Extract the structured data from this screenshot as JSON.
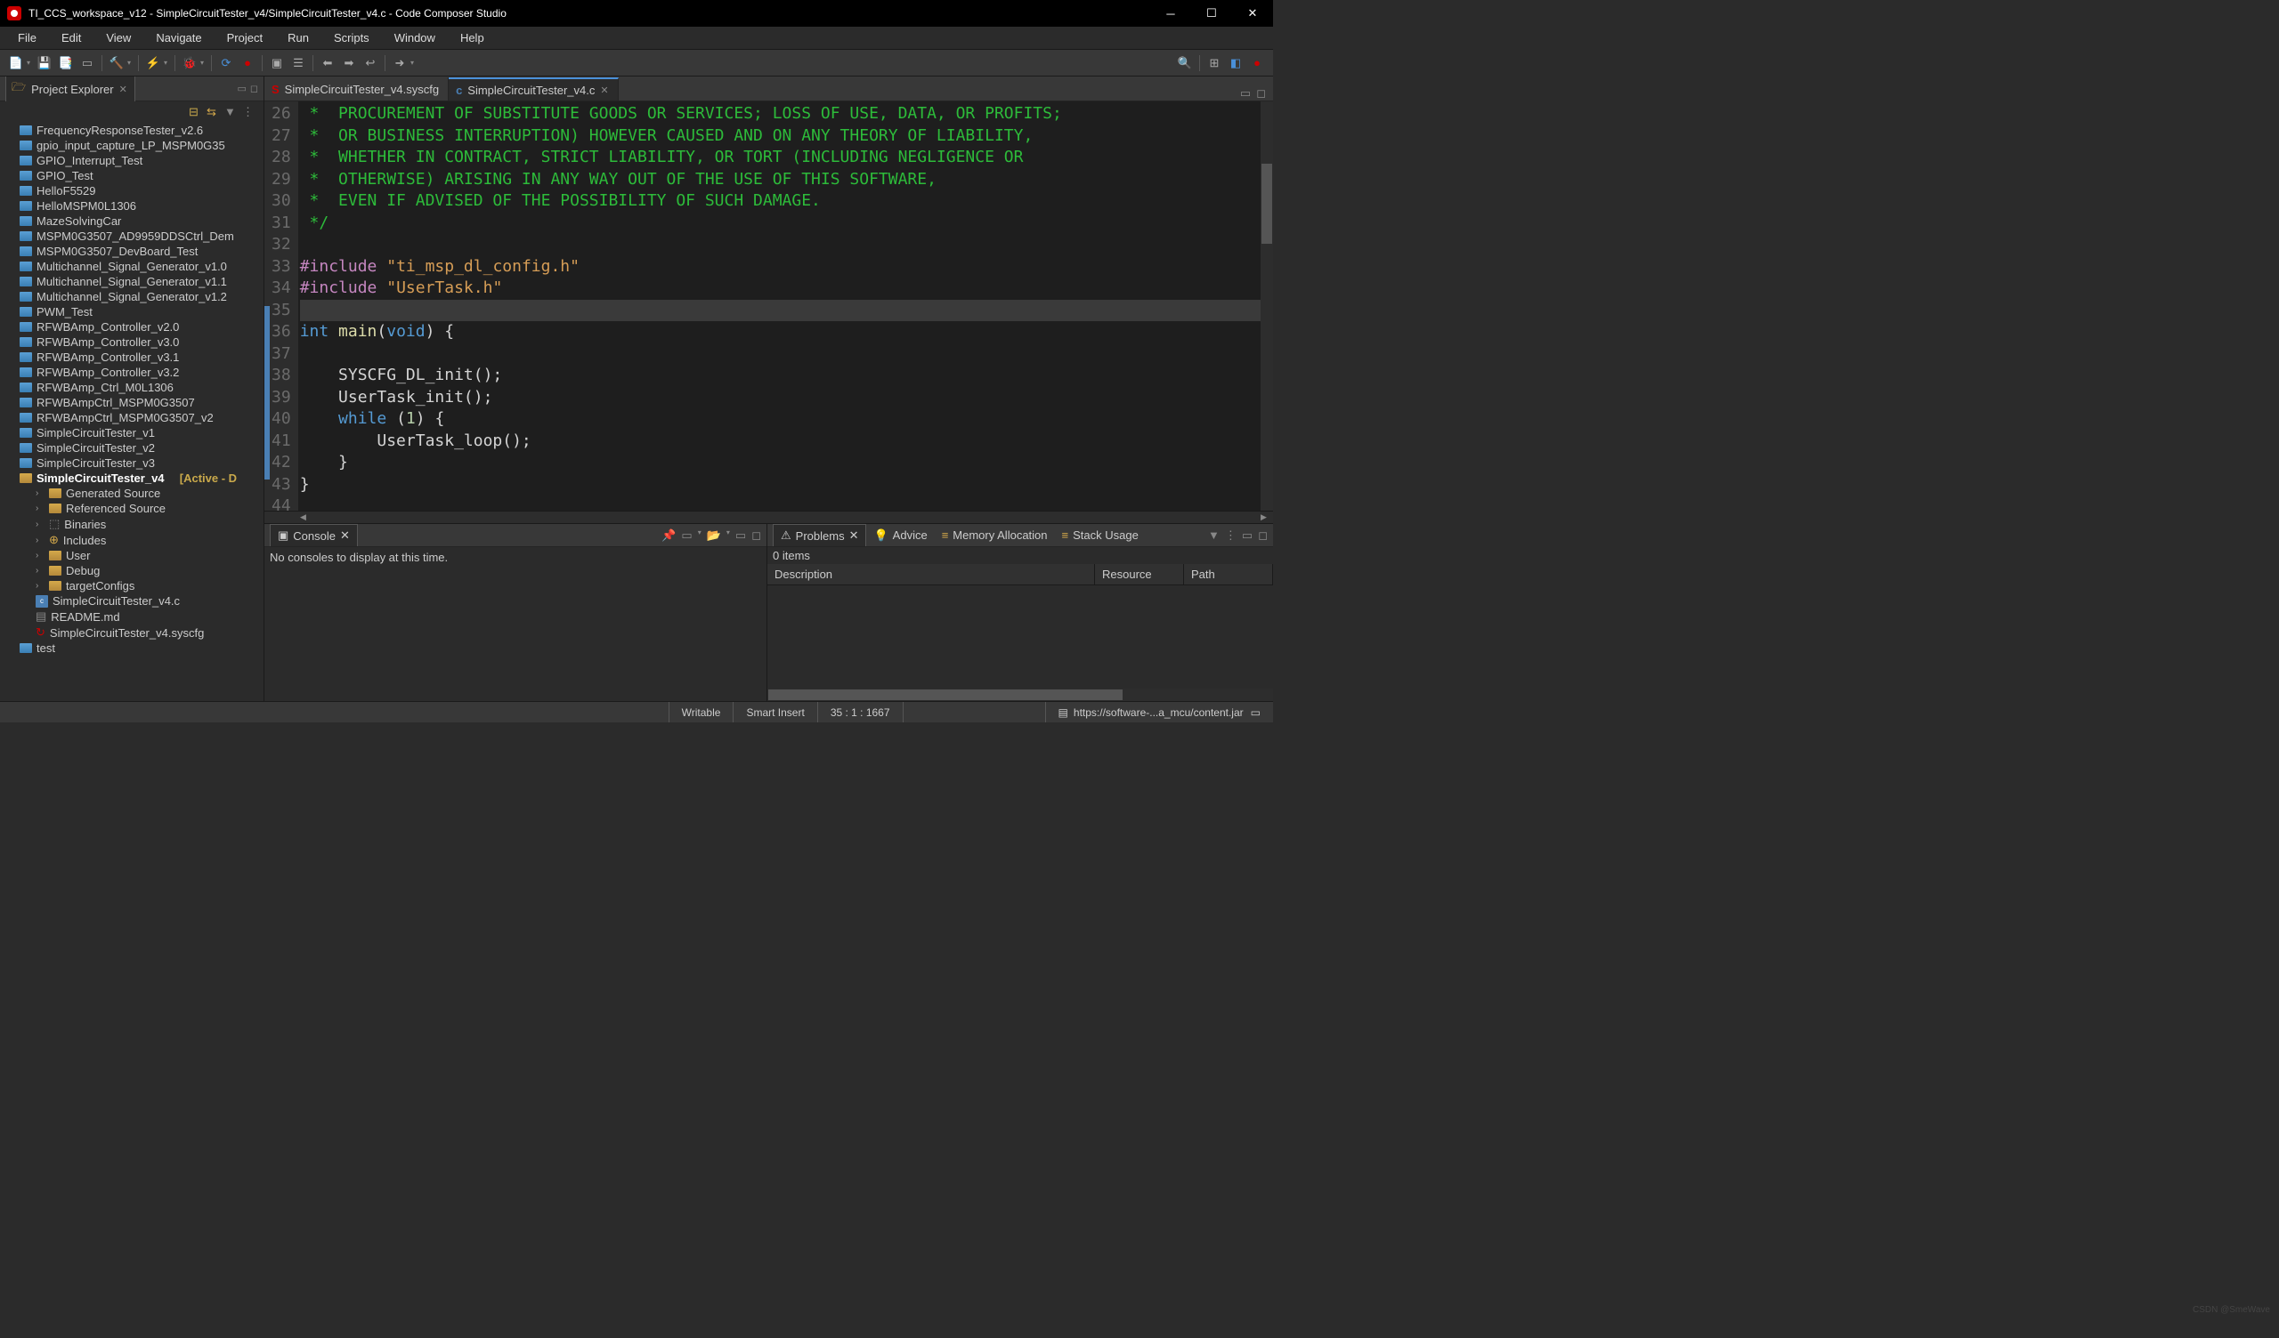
{
  "window": {
    "title": "TI_CCS_workspace_v12 - SimpleCircuitTester_v4/SimpleCircuitTester_v4.c - Code Composer Studio"
  },
  "menu": [
    "File",
    "Edit",
    "View",
    "Navigate",
    "Project",
    "Run",
    "Scripts",
    "Window",
    "Help"
  ],
  "project_explorer": {
    "title": "Project Explorer",
    "projects": [
      "FrequencyResponseTester_v2.6",
      "gpio_input_capture_LP_MSPM0G35",
      "GPIO_Interrupt_Test",
      "GPIO_Test",
      "HelloF5529",
      "HelloMSPM0L1306",
      "MazeSolvingCar",
      "MSPM0G3507_AD9959DDSCtrl_Dem",
      "MSPM0G3507_DevBoard_Test",
      "Multichannel_Signal_Generator_v1.0",
      "Multichannel_Signal_Generator_v1.1",
      "Multichannel_Signal_Generator_v1.2",
      "PWM_Test",
      "RFWBAmp_Controller_v2.0",
      "RFWBAmp_Controller_v3.0",
      "RFWBAmp_Controller_v3.1",
      "RFWBAmp_Controller_v3.2",
      "RFWBAmp_Ctrl_M0L1306",
      "RFWBAmpCtrl_MSPM0G3507",
      "RFWBAmpCtrl_MSPM0G3507_v2",
      "SimpleCircuitTester_v1",
      "SimpleCircuitTester_v2",
      "SimpleCircuitTester_v3"
    ],
    "active_project": "SimpleCircuitTester_v4",
    "active_badge": "[Active - D",
    "children": [
      {
        "label": "Generated Source",
        "type": "folder-gen"
      },
      {
        "label": "Referenced Source",
        "type": "folder-gen"
      },
      {
        "label": "Binaries",
        "type": "binaries"
      },
      {
        "label": "Includes",
        "type": "includes"
      },
      {
        "label": "User",
        "type": "folder"
      },
      {
        "label": "Debug",
        "type": "folder"
      },
      {
        "label": "targetConfigs",
        "type": "folder"
      },
      {
        "label": "SimpleCircuitTester_v4.c",
        "type": "cfile"
      },
      {
        "label": "README.md",
        "type": "file"
      },
      {
        "label": "SimpleCircuitTester_v4.syscfg",
        "type": "syscfg"
      }
    ],
    "tail": "test"
  },
  "editor": {
    "tabs": [
      {
        "label": "SimpleCircuitTester_v4.syscfg",
        "active": false,
        "icon": "S"
      },
      {
        "label": "SimpleCircuitTester_v4.c",
        "active": true,
        "icon": "c"
      }
    ],
    "first_line_no": 26,
    "lines": [
      {
        "type": "comment",
        "text": " *  PROCUREMENT OF SUBSTITUTE GOODS OR SERVICES; LOSS OF USE, DATA, OR PROFITS;"
      },
      {
        "type": "comment",
        "text": " *  OR BUSINESS INTERRUPTION) HOWEVER CAUSED AND ON ANY THEORY OF LIABILITY,"
      },
      {
        "type": "comment",
        "text": " *  WHETHER IN CONTRACT, STRICT LIABILITY, OR TORT (INCLUDING NEGLIGENCE OR"
      },
      {
        "type": "comment",
        "text": " *  OTHERWISE) ARISING IN ANY WAY OUT OF THE USE OF THIS SOFTWARE,"
      },
      {
        "type": "comment",
        "text": " *  EVEN IF ADVISED OF THE POSSIBILITY OF SUCH DAMAGE."
      },
      {
        "type": "comment",
        "text": " */"
      },
      {
        "type": "blank",
        "text": ""
      },
      {
        "type": "include",
        "header": "ti_msp_dl_config.h"
      },
      {
        "type": "include",
        "header": "UserTask.h"
      },
      {
        "type": "cursor",
        "text": ""
      },
      {
        "type": "main_sig"
      },
      {
        "type": "blank",
        "text": ""
      },
      {
        "type": "call",
        "name": "SYSCFG_DL_init"
      },
      {
        "type": "call",
        "name": "UserTask_init"
      },
      {
        "type": "while"
      },
      {
        "type": "loopcall",
        "name": "UserTask_loop"
      },
      {
        "type": "closebrace1"
      },
      {
        "type": "closebrace0"
      },
      {
        "type": "blank",
        "text": ""
      }
    ]
  },
  "console": {
    "title": "Console",
    "message": "No consoles to display at this time."
  },
  "problems": {
    "title": "Problems",
    "count": "0 items",
    "columns": [
      "Description",
      "Resource",
      "Path"
    ],
    "other_tabs": [
      "Advice",
      "Memory Allocation",
      "Stack Usage"
    ]
  },
  "status": {
    "writable": "Writable",
    "insert": "Smart Insert",
    "pos": "35 : 1 : 1667",
    "url": "https://software-...a_mcu/content.jar"
  },
  "watermark": "CSDN @SmeWave"
}
